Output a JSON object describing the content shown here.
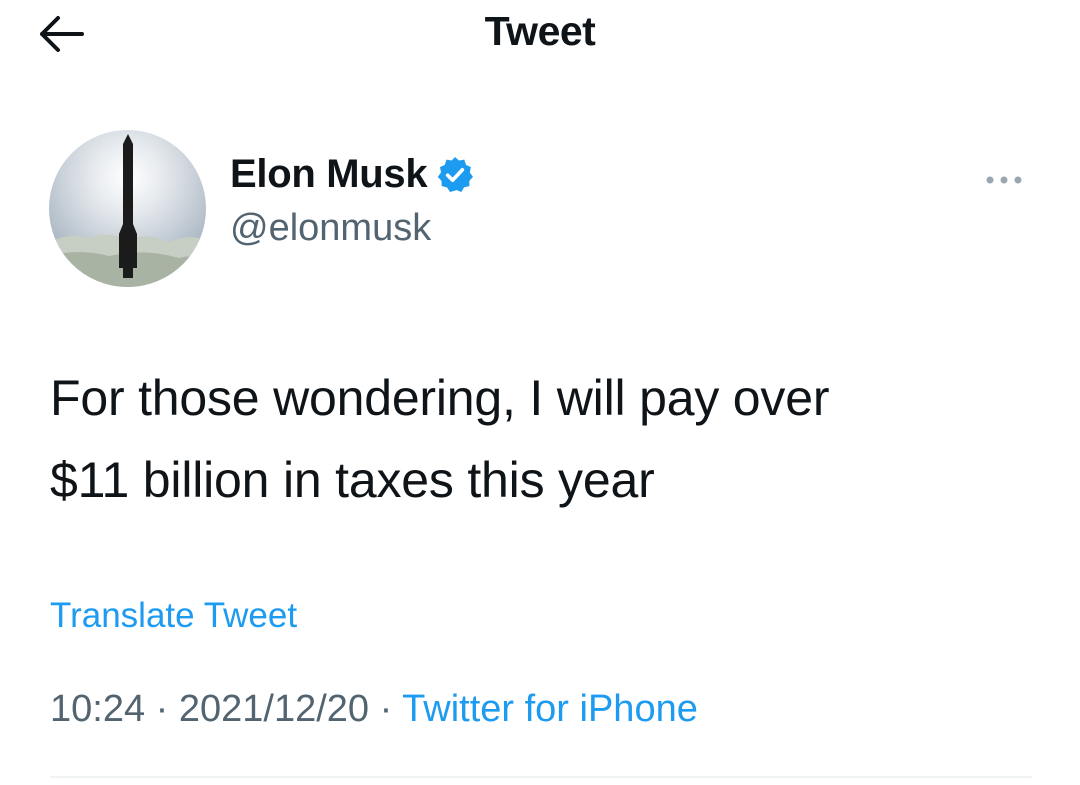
{
  "header": {
    "title": "Tweet",
    "back_icon": "arrow-left-icon"
  },
  "tweet": {
    "author": {
      "name": "Elon Musk",
      "handle": "@elonmusk",
      "verified": true,
      "verified_color": "#1d9bf0"
    },
    "text_lines": [
      "For those wondering, I will pay over",
      "$11 billion in taxes this year"
    ],
    "translate_label": "Translate Tweet",
    "time": "10:24",
    "separator": "·",
    "date": "2021/12/20",
    "source": "Twitter for iPhone",
    "more_icon": "more-horizontal-icon"
  },
  "colors": {
    "text": "#0f1419",
    "secondary": "#536471",
    "link": "#1d9bf0"
  }
}
